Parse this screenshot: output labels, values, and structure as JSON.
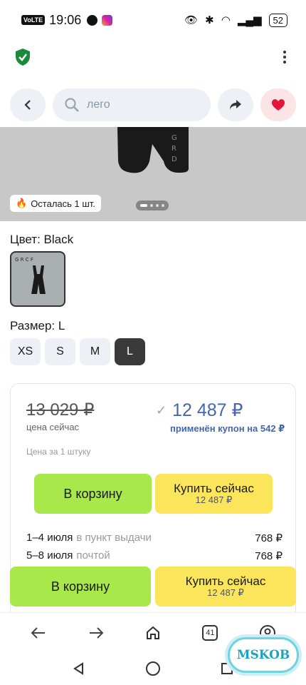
{
  "status_bar": {
    "volte": "VoLTE",
    "time": "19:06",
    "battery": "52"
  },
  "header": {
    "search_placeholder": "лего"
  },
  "product": {
    "stock_badge": "Осталась 1 шт.",
    "gallery_page": 1,
    "gallery_pages": 4,
    "color_label": "Цвет: Black",
    "size_label": "Размер: L",
    "sizes": [
      "XS",
      "S",
      "M",
      "L"
    ],
    "selected_size": "L"
  },
  "price_card": {
    "old_price": "13 029 ₽",
    "price_now_label": "цена сейчас",
    "new_price": "12 487 ₽",
    "coupon_text": "применён купон на 542 ₽",
    "unit_label": "Цена за 1 штуку",
    "cart_label": "В корзину",
    "buy_label": "Купить сейчас",
    "buy_price": "12 487 ₽",
    "delivery": [
      {
        "dates": "1–4 июля",
        "method": "в пункт выдачи",
        "cost": "768 ₽"
      },
      {
        "dates": "5–8 июля",
        "method": "почтой",
        "cost": "768 ₽"
      }
    ]
  },
  "sticky_bar": {
    "cart_label": "В корзину",
    "buy_label": "Купить сейчас",
    "buy_price": "12 487 ₽"
  },
  "browser_nav": {
    "tab_count": "41"
  },
  "watermark": "MSKOB",
  "colors": {
    "cart_green": "#a8e84b",
    "buy_yellow": "#fbe55a",
    "price_blue": "#4566a8"
  }
}
